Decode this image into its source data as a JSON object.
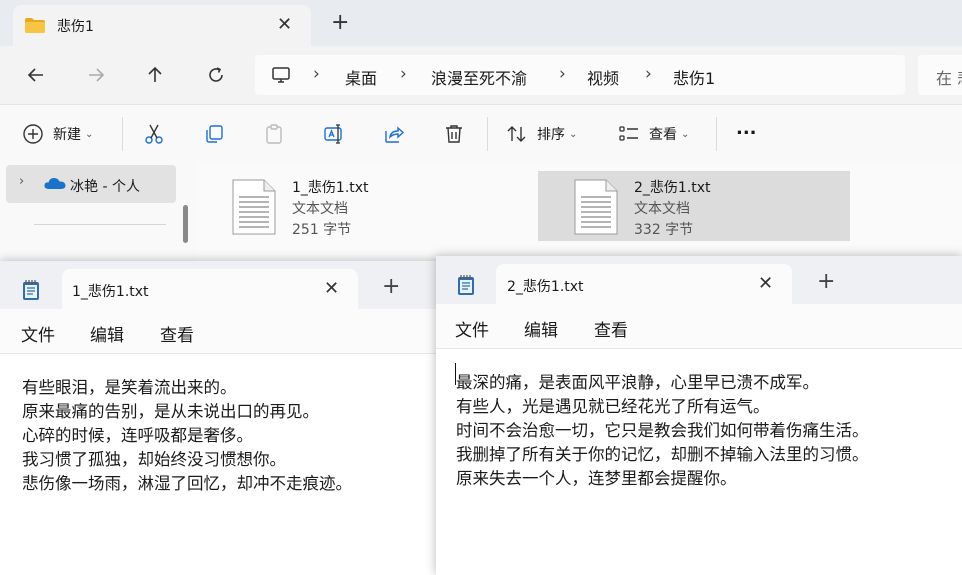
{
  "explorer": {
    "tab_title": "悲伤1",
    "breadcrumb": [
      "桌面",
      "浪漫至死不渝",
      "视频",
      "悲伤1"
    ],
    "search_placeholder": "在 悲",
    "toolbar": {
      "new_label": "新建",
      "sort_label": "排序",
      "view_label": "查看",
      "more_label": "..."
    },
    "sidebar": {
      "onedrive_label": "冰艳 - 个人"
    },
    "files": [
      {
        "name": "1_悲伤1.txt",
        "type": "文本文档",
        "size": "251 字节",
        "selected": false
      },
      {
        "name": "2_悲伤1.txt",
        "type": "文本文档",
        "size": "332 字节",
        "selected": true
      }
    ]
  },
  "notepad1": {
    "tab_title": "1_悲伤1.txt",
    "menu": [
      "文件",
      "编辑",
      "查看"
    ],
    "lines": [
      "有些眼泪，是笑着流出来的。",
      "原来最痛的告别，是从未说出口的再见。",
      "心碎的时候，连呼吸都是奢侈。",
      "我习惯了孤独，却始终没习惯想你。",
      "悲伤像一场雨，淋湿了回忆，却冲不走痕迹。"
    ]
  },
  "notepad2": {
    "tab_title": "2_悲伤1.txt",
    "menu": [
      "文件",
      "编辑",
      "查看"
    ],
    "lines": [
      "最深的痛，是表面风平浪静，心里早已溃不成军。",
      "有些人，光是遇见就已经花光了所有运气。",
      "时间不会治愈一切，它只是教会我们如何带着伤痛生活。",
      "我删掉了所有关于你的记忆，却删不掉输入法里的习惯。",
      "原来失去一个人，连梦里都会提醒你。"
    ]
  },
  "colors": {
    "accent_blue": "#1f6fd0",
    "onedrive_blue": "#1a73c8",
    "notepad_icon": "#2f6ea8"
  }
}
